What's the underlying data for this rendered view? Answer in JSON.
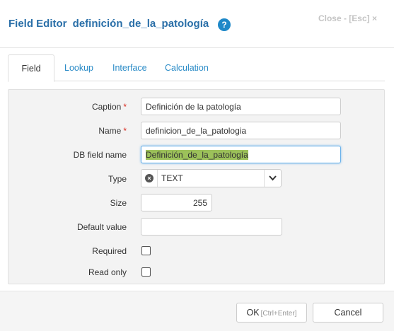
{
  "header": {
    "title_prefix": "Field Editor",
    "field_name": "definición_de_la_patología",
    "help_icon": "?",
    "close_label": "Close - [Esc] ×"
  },
  "tabs": [
    {
      "label": "Field",
      "active": true
    },
    {
      "label": "Lookup",
      "active": false
    },
    {
      "label": "Interface",
      "active": false
    },
    {
      "label": "Calculation",
      "active": false
    }
  ],
  "form": {
    "caption": {
      "label": "Caption",
      "required_mark": "*",
      "value": "Definición de la patología"
    },
    "name": {
      "label": "Name",
      "required_mark": "*",
      "value": "definicion_de_la_patologia"
    },
    "db_field_name": {
      "label": "DB field name",
      "value": "Definición_de_la_patología"
    },
    "type": {
      "label": "Type",
      "value": "TEXT",
      "clear_icon": "×",
      "arrow_icon": "chevron-down-icon"
    },
    "size": {
      "label": "Size",
      "value": "255"
    },
    "default_value": {
      "label": "Default value",
      "value": ""
    },
    "required": {
      "label": "Required",
      "checked": false
    },
    "read_only": {
      "label": "Read only",
      "checked": false
    }
  },
  "footer": {
    "ok_label": "OK",
    "ok_hint": "[Ctrl+Enter]",
    "cancel_label": "Cancel"
  },
  "colors": {
    "title": "#2a6fa8",
    "tab_link": "#2a8bc7",
    "required": "#d9261c",
    "selection": "#9cc15a",
    "help_icon": "#1e88c8"
  }
}
